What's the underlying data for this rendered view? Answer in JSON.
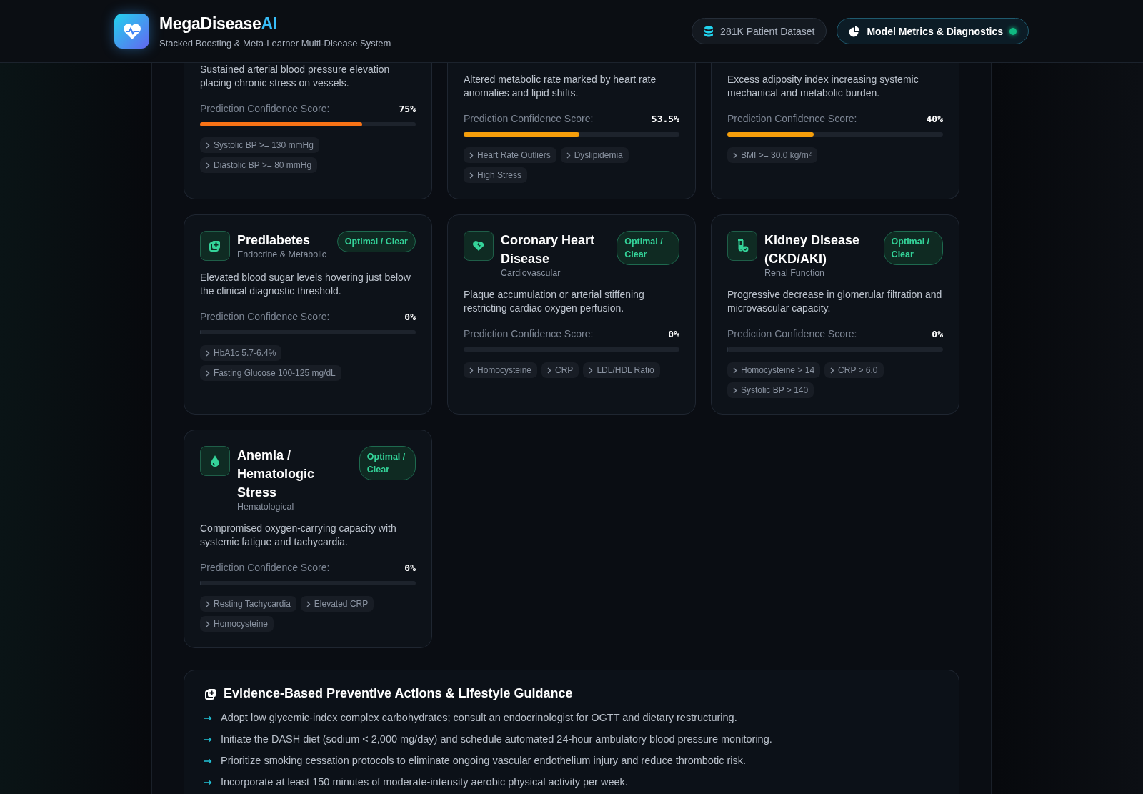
{
  "header": {
    "brand_name": "MegaDisease",
    "brand_suffix": "AI",
    "subtitle": "Stacked Boosting & Meta-Learner Multi-Disease System",
    "buttons": [
      {
        "label": "281K Patient Dataset",
        "selected": false,
        "online": false
      },
      {
        "label": "Model Metrics & Diagnostics",
        "selected": true,
        "online": true
      }
    ]
  },
  "cards": [
    {
      "kind": "cut",
      "description": "Sustained arterial blood pressure elevation placing chronic stress on vessels.",
      "score_label": "Prediction Confidence Score:",
      "score": "75%",
      "level": 0.75,
      "color": "#f97316",
      "tags": [
        "Systolic BP >= 130 mmHg",
        "Diastolic BP >= 80 mmHg"
      ]
    },
    {
      "kind": "cut",
      "description": "Altered metabolic rate marked by heart rate anomalies and lipid shifts.",
      "score_label": "Prediction Confidence Score:",
      "score": "53.5%",
      "level": 0.535,
      "color": "#f59e0b",
      "tags": [
        "Heart Rate Outliers",
        "Dyslipidemia",
        "High Stress"
      ]
    },
    {
      "kind": "cut",
      "description": "Excess adiposity index increasing systemic mechanical and metabolic burden.",
      "score_label": "Prediction Confidence Score:",
      "score": "40%",
      "level": 0.4,
      "color": "#f59e0b",
      "tags": [
        "BMI >= 30.0 kg/m²"
      ]
    },
    {
      "kind": "full",
      "title": "Prediabetes",
      "category": "Endocrine & Metabolic",
      "badge": "Optimal / Clear",
      "description": "Elevated blood sugar levels hovering just below the clinical diagnostic threshold.",
      "score_label": "Prediction Confidence Score:",
      "score": "0%",
      "level": 0,
      "tags": [
        "HbA1c 5.7-6.4%",
        "Fasting Glucose 100-125 mg/dL"
      ]
    },
    {
      "kind": "full",
      "title": "Coronary Heart Disease",
      "category": "Cardiovascular",
      "badge": "Optimal / Clear",
      "description": "Plaque accumulation or arterial stiffening restricting cardiac oxygen perfusion.",
      "score_label": "Prediction Confidence Score:",
      "score": "0%",
      "level": 0,
      "tags": [
        "Homocysteine",
        "CRP",
        "LDL/HDL Ratio"
      ]
    },
    {
      "kind": "full",
      "title": "Kidney Disease (CKD/AKI)",
      "category": "Renal Function",
      "badge": "Optimal / Clear",
      "description": "Progressive decrease in glomerular filtration and microvascular capacity.",
      "score_label": "Prediction Confidence Score:",
      "score": "0%",
      "level": 0,
      "tags": [
        "Homocysteine > 14",
        "CRP > 6.0",
        "Systolic BP > 140"
      ]
    },
    {
      "kind": "full",
      "title": "Anemia / Hematologic Stress",
      "category": "Hematological",
      "badge": "Optimal / Clear",
      "description": "Compromised oxygen-carrying capacity with systemic fatigue and tachycardia.",
      "score_label": "Prediction Confidence Score:",
      "score": "0%",
      "level": 0,
      "tags": [
        "Resting Tachycardia",
        "Elevated CRP",
        "Homocysteine"
      ]
    }
  ],
  "guidance": {
    "title": "Evidence-Based Preventive Actions & Lifestyle Guidance",
    "items": [
      "Adopt low glycemic-index complex carbohydrates; consult an endocrinologist for OGTT and dietary restructuring.",
      "Initiate the DASH diet (sodium < 2,000 mg/day) and schedule automated 24-hour ambulatory blood pressure monitoring.",
      "Prioritize smoking cessation protocols to eliminate ongoing vascular endothelium injury and reduce thrombotic risk.",
      "Incorporate at least 150 minutes of moderate-intensity aerobic physical activity per week."
    ]
  }
}
